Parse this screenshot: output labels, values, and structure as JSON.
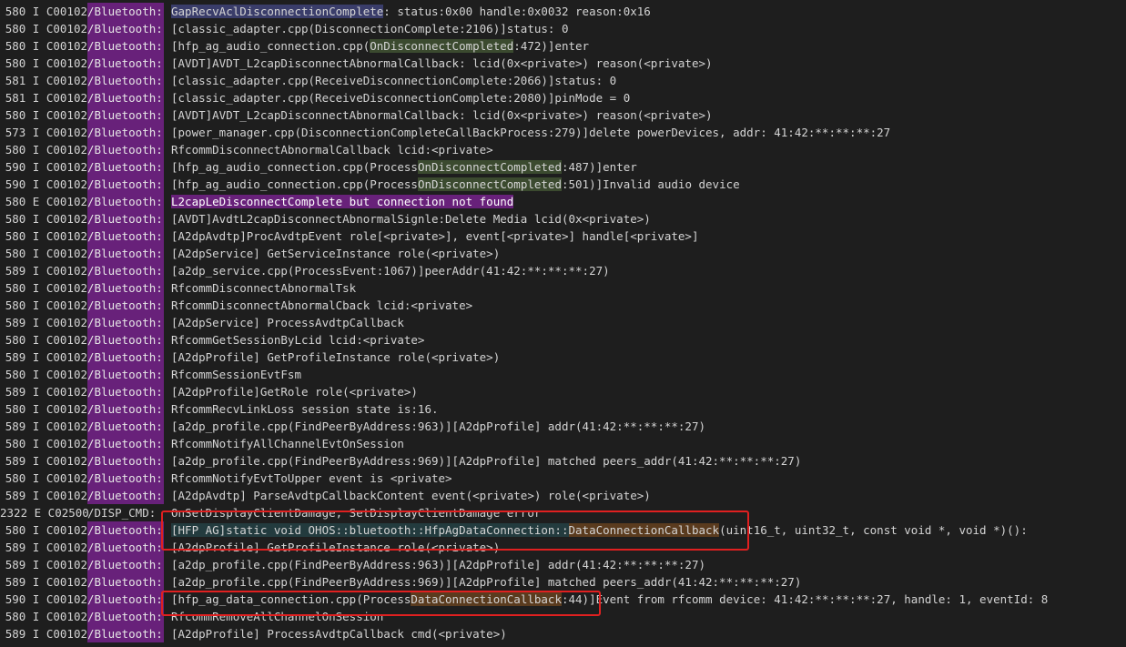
{
  "log_lines": [
    {
      "prefix": "580 I C00102",
      "tag": "/Bluetooth:",
      "segments": [
        {
          "text": "GapRecvAclDisconnectionComplete",
          "hl": "blue"
        },
        {
          "text": ": status:0x00 handle:0x0032 reason:0x16"
        }
      ]
    },
    {
      "prefix": "580 I C00102",
      "tag": "/Bluetooth:",
      "segments": [
        {
          "text": "[classic_adapter.cpp(DisconnectionComplete:2106)]status: 0"
        }
      ]
    },
    {
      "prefix": "580 I C00102",
      "tag": "/Bluetooth:",
      "segments": [
        {
          "text": "[hfp_ag_audio_connection.cpp("
        },
        {
          "text": "OnDisconnectCompleted",
          "hl": "green"
        },
        {
          "text": ":472)]enter"
        }
      ]
    },
    {
      "prefix": "580 I C00102",
      "tag": "/Bluetooth:",
      "segments": [
        {
          "text": "[AVDT]AVDT_L2capDisconnectAbnormalCallback: lcid(0x<private>) reason(<private>)"
        }
      ]
    },
    {
      "prefix": "581 I C00102",
      "tag": "/Bluetooth:",
      "segments": [
        {
          "text": "[classic_adapter.cpp(ReceiveDisconnectionComplete:2066)]status: 0"
        }
      ]
    },
    {
      "prefix": "581 I C00102",
      "tag": "/Bluetooth:",
      "segments": [
        {
          "text": "[classic_adapter.cpp(ReceiveDisconnectionComplete:2080)]pinMode = 0"
        }
      ]
    },
    {
      "prefix": "580 I C00102",
      "tag": "/Bluetooth:",
      "segments": [
        {
          "text": "[AVDT]AVDT_L2capDisconnectAbnormalCallback: lcid(0x<private>) reason(<private>)"
        }
      ]
    },
    {
      "prefix": "573 I C00102",
      "tag": "/Bluetooth:",
      "segments": [
        {
          "text": "[power_manager.cpp(DisconnectionCompleteCallBackProcess:279)]delete powerDevices, addr: 41:42:**:**:**:27"
        }
      ]
    },
    {
      "prefix": "580 I C00102",
      "tag": "/Bluetooth:",
      "segments": [
        {
          "text": "RfcommDisconnectAbnormalCallback lcid:<private>"
        }
      ]
    },
    {
      "prefix": "590 I C00102",
      "tag": "/Bluetooth:",
      "segments": [
        {
          "text": "[hfp_ag_audio_connection.cpp(Process"
        },
        {
          "text": "OnDisconnectCompleted",
          "hl": "green"
        },
        {
          "text": ":487)]enter"
        }
      ]
    },
    {
      "prefix": "590 I C00102",
      "tag": "/Bluetooth:",
      "segments": [
        {
          "text": "[hfp_ag_audio_connection.cpp(Process"
        },
        {
          "text": "OnDisconnectCompleted",
          "hl": "green"
        },
        {
          "text": ":501)]Invalid audio device"
        }
      ]
    },
    {
      "prefix": "580 E C00102",
      "tag": "/Bluetooth:",
      "segments": [
        {
          "text": "L2capLeDisconnectComplete but connection not found",
          "hl": "purple"
        }
      ]
    },
    {
      "prefix": "580 I C00102",
      "tag": "/Bluetooth:",
      "segments": [
        {
          "text": "[AVDT]AvdtL2capDisconnectAbnormalSignle:Delete Media lcid(0x<private>)"
        }
      ]
    },
    {
      "prefix": "580 I C00102",
      "tag": "/Bluetooth:",
      "segments": [
        {
          "text": "[A2dpAvdtp]ProcAvdtpEvent role[<private>], event[<private>] handle[<private>]"
        }
      ]
    },
    {
      "prefix": "580 I C00102",
      "tag": "/Bluetooth:",
      "segments": [
        {
          "text": "[A2dpService] GetServiceInstance role(<private>)"
        }
      ]
    },
    {
      "prefix": "589 I C00102",
      "tag": "/Bluetooth:",
      "segments": [
        {
          "text": "[a2dp_service.cpp(ProcessEvent:1067)]peerAddr(41:42:**:**:**:27)"
        }
      ]
    },
    {
      "prefix": "580 I C00102",
      "tag": "/Bluetooth:",
      "segments": [
        {
          "text": "RfcommDisconnectAbnormalTsk"
        }
      ]
    },
    {
      "prefix": "580 I C00102",
      "tag": "/Bluetooth:",
      "segments": [
        {
          "text": "RfcommDisconnectAbnormalCback lcid:<private>"
        }
      ]
    },
    {
      "prefix": "589 I C00102",
      "tag": "/Bluetooth:",
      "segments": [
        {
          "text": "[A2dpService] ProcessAvdtpCallback"
        }
      ]
    },
    {
      "prefix": "580 I C00102",
      "tag": "/Bluetooth:",
      "segments": [
        {
          "text": "RfcommGetSessionByLcid lcid:<private>"
        }
      ]
    },
    {
      "prefix": "589 I C00102",
      "tag": "/Bluetooth:",
      "segments": [
        {
          "text": "[A2dpProfile] GetProfileInstance role(<private>)"
        }
      ]
    },
    {
      "prefix": "580 I C00102",
      "tag": "/Bluetooth:",
      "segments": [
        {
          "text": "RfcommSessionEvtFsm"
        }
      ]
    },
    {
      "prefix": "589 I C00102",
      "tag": "/Bluetooth:",
      "segments": [
        {
          "text": "[A2dpProfile]GetRole role(<private>)"
        }
      ]
    },
    {
      "prefix": "580 I C00102",
      "tag": "/Bluetooth:",
      "segments": [
        {
          "text": "RfcommRecvLinkLoss session state is:16."
        }
      ]
    },
    {
      "prefix": "589 I C00102",
      "tag": "/Bluetooth:",
      "segments": [
        {
          "text": "[a2dp_profile.cpp(FindPeerByAddress:963)][A2dpProfile] addr(41:42:**:**:**:27)"
        }
      ]
    },
    {
      "prefix": "580 I C00102",
      "tag": "/Bluetooth:",
      "segments": [
        {
          "text": "RfcommNotifyAllChannelEvtOnSession"
        }
      ]
    },
    {
      "prefix": "589 I C00102",
      "tag": "/Bluetooth:",
      "segments": [
        {
          "text": "[a2dp_profile.cpp(FindPeerByAddress:969)][A2dpProfile] matched peers_addr(41:42:**:**:**:27)"
        }
      ]
    },
    {
      "prefix": "580 I C00102",
      "tag": "/Bluetooth:",
      "segments": [
        {
          "text": "RfcommNotifyEvtToUpper event is <private>"
        }
      ]
    },
    {
      "prefix": "589 I C00102",
      "tag": "/Bluetooth:",
      "segments": [
        {
          "text": "[A2dpAvdtp] ParseAvdtpCallbackContent event(<private>) role(<private>)"
        }
      ]
    },
    {
      "prefix": "2322 E C02500",
      "tag": "/DISP_CMD:",
      "tag_plain": true,
      "segments": [
        {
          "text": "OnSetDisplayClientDamage, SetDisplayClientDamage error"
        }
      ]
    },
    {
      "prefix": "580 I C00102",
      "tag": "/Bluetooth:",
      "segments": [
        {
          "text": "[HFP AG]static void OHOS::bluetooth::HfpAgDataConnection::",
          "hl": "teal"
        },
        {
          "text": "DataConnectionCallback",
          "hl": "orange"
        },
        {
          "text": "(uint16_t, uint32_t, const void *, void *)():"
        }
      ]
    },
    {
      "prefix": "589 I C00102",
      "tag": "/Bluetooth:",
      "segments": [
        {
          "text": "[A2dpProfile] GetProfileInstance role(<private>)"
        }
      ]
    },
    {
      "prefix": "589 I C00102",
      "tag": "/Bluetooth:",
      "segments": [
        {
          "text": "[a2dp_profile.cpp(FindPeerByAddress:963)][A2dpProfile] addr(41:42:**:**:**:27)"
        }
      ]
    },
    {
      "prefix": "589 I C00102",
      "tag": "/Bluetooth:",
      "segments": [
        {
          "text": "[a2dp_profile.cpp(FindPeerByAddress:969)][A2dpProfile] matched peers_addr(41:42:**:**:**:27)"
        }
      ]
    },
    {
      "prefix": "590 I C00102",
      "tag": "/Bluetooth:",
      "segments": [
        {
          "text": "[hfp_ag_data_connection.cpp(Process"
        },
        {
          "text": "DataConnectionCallback",
          "hl": "orange"
        },
        {
          "text": ":44)]Event from rfcomm device: 41:42:**:**:**:27, handle: 1, eventId: 8"
        }
      ]
    },
    {
      "prefix": "580 I C00102",
      "tag": "/Bluetooth:",
      "segments": [
        {
          "text": "RfcommRemoveAllChannelOnSession"
        }
      ]
    },
    {
      "prefix": "589 I C00102",
      "tag": "/Bluetooth:",
      "segments": [
        {
          "text": "[A2dpProfile] ProcessAvdtpCallback cmd(<private>)"
        }
      ]
    }
  ],
  "annotation_boxes": [
    {
      "label": "HfpAgDataConnection DataConnectionCallback",
      "line": 30
    },
    {
      "label": "ProcessDataConnectionCallback",
      "line": 34
    }
  ]
}
